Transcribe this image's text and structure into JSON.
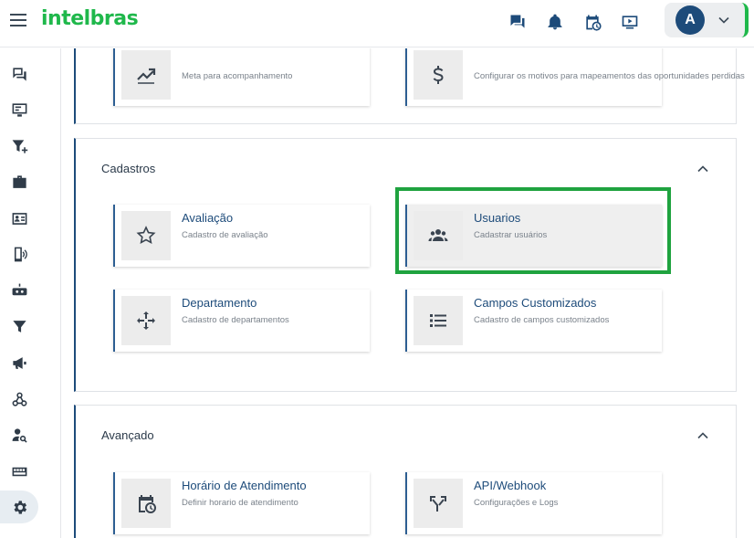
{
  "header": {
    "logo_text": "intelbras",
    "user_initial": "A",
    "icons": [
      "menu-icon",
      "chat-icon",
      "bell-icon",
      "calendar-clock-icon",
      "video-icon",
      "chevron-down-icon"
    ]
  },
  "sidebar": {
    "items": [
      "chat-icon",
      "monitor-icon",
      "filter-plus-icon",
      "briefcase-icon",
      "id-card-icon",
      "phone-ring-icon",
      "robot-icon",
      "funnel-icon",
      "megaphone-icon",
      "webhook-icon",
      "user-search-icon",
      "keyboard-icon",
      "gear-icon"
    ],
    "active": "gear-icon"
  },
  "top_section": {
    "cards": [
      {
        "title": "",
        "desc": "Meta para acompanhamento",
        "icon": "trending-chart-icon"
      },
      {
        "title": "",
        "desc": "Configurar os motivos para mapeamentos das oportunidades perdidas",
        "icon": "dollar-icon"
      }
    ]
  },
  "cadastros": {
    "title": "Cadastros",
    "cards": [
      {
        "title": "Avaliação",
        "desc": "Cadastro de avaliação",
        "icon": "star-icon"
      },
      {
        "title": "Usuarios",
        "desc": "Cadastrar usuários",
        "icon": "users-icon"
      },
      {
        "title": "Departamento",
        "desc": "Cadastro de departamentos",
        "icon": "move-arrows-icon"
      },
      {
        "title": "Campos Customizados",
        "desc": "Cadastro de campos customizados",
        "icon": "list-icon"
      }
    ]
  },
  "avancado": {
    "title": "Avançado",
    "cards": [
      {
        "title": "Horário de Atendimento",
        "desc": "Definir horario de atendimento",
        "icon": "calendar-clock-icon"
      },
      {
        "title": "API/Webhook",
        "desc": "Configurações e Logs",
        "icon": "fork-arrows-icon"
      }
    ]
  },
  "colors": {
    "brand_green": "#1fb84b",
    "primary_blue": "#1d4b7a",
    "highlight_green": "#1fa33f"
  }
}
